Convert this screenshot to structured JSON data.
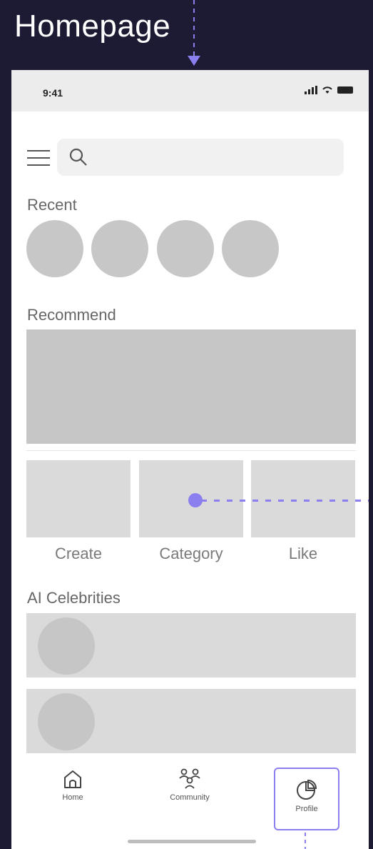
{
  "frame": {
    "title": "Homepage"
  },
  "status_bar": {
    "time": "9:41"
  },
  "sections": {
    "recent_label": "Recent",
    "recommend_label": "Recommend",
    "celebrities_label": "AI Celebrities"
  },
  "tiles": [
    {
      "label": "Create"
    },
    {
      "label": "Category"
    },
    {
      "label": "Like"
    }
  ],
  "tab_bar": {
    "items": [
      {
        "label": "Home",
        "icon": "home-icon"
      },
      {
        "label": "Community",
        "icon": "community-icon"
      },
      {
        "label": "Profile",
        "icon": "profile-icon",
        "selected": true
      }
    ]
  },
  "colors": {
    "background": "#1c1b33",
    "accent": "#8b7ff0",
    "placeholder": "#c6c6c6"
  }
}
